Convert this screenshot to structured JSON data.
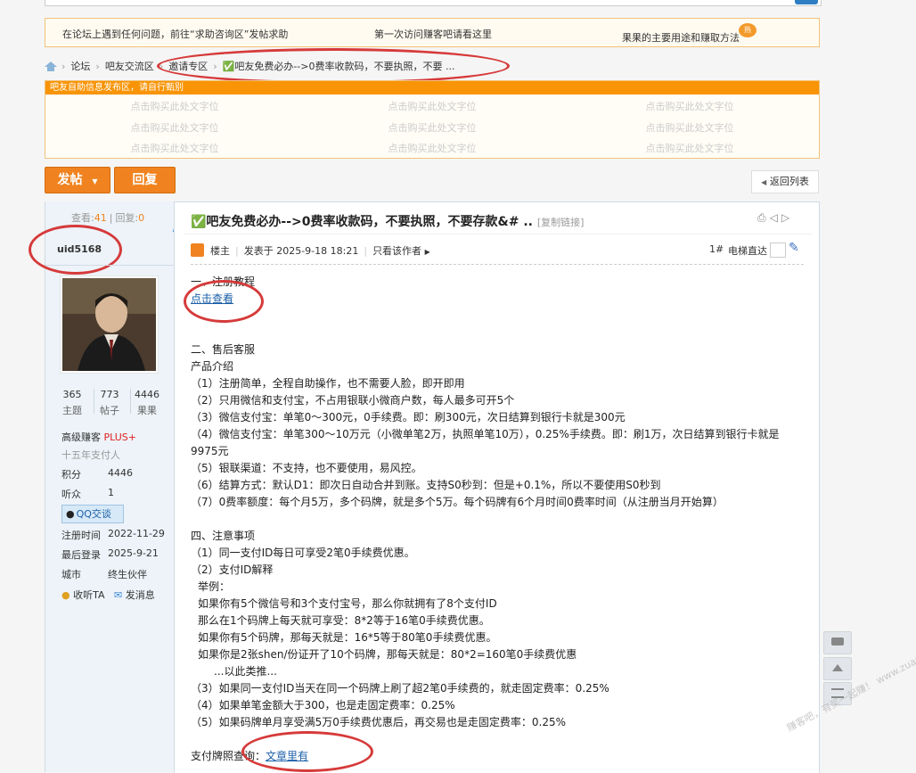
{
  "notice": {
    "left": "在论坛上遇到任何问题，前往“求助咨询区”发帖求助",
    "mid": "第一次访问赚客吧请看这里",
    "right": "果果的主要用途和赚取方法",
    "badge": "热"
  },
  "breadcrumb": [
    "论坛",
    "吧友交流区",
    "邀请专区",
    "✅吧友免费必办-->0费率收款码，不要执照，不要 ..."
  ],
  "ad": {
    "header": "吧友自助信息发布区，请自行甄别",
    "cell": "点击购买此处文字位"
  },
  "actions": {
    "post": "发帖",
    "reply": "回复",
    "back": "返回列表"
  },
  "user": {
    "views_label": "查看:",
    "views": "41",
    "replies_label": "回复:",
    "replies": "0",
    "name": "uid5168",
    "topics": "365",
    "topics_label": "主题",
    "posts": "773",
    "posts_label": "帖子",
    "fruit": "4446",
    "fruit_label": "果果",
    "level": "高级赚客",
    "plus": "PLUS+",
    "title2": "十五年支付人",
    "points_label": "积分",
    "points": "4446",
    "fans_label": "听众",
    "fans": "1",
    "qq": "QQ交谈",
    "reg_label": "注册时间",
    "reg": "2022-11-29",
    "last_label": "最后登录",
    "last": "2025-9-21",
    "city_label": "城市",
    "city": "终生伙伴",
    "follow": "收听TA",
    "msg": "发消息"
  },
  "post": {
    "title": "✅吧友免费必办-->0费率收款码，不要执照，不要存款&# ..",
    "copy": "[复制链接]",
    "owner": "楼主",
    "time": "发表于 2025-9-18 18:21",
    "author_only": "只看该作者",
    "floor": "1#",
    "jump": "电梯直达"
  },
  "content": {
    "l1": "一、注册教程",
    "link1": "点击查看",
    "l2": "二、售后客服",
    "l3": "产品介绍",
    "l4": "（1）注册简单，全程自助操作，也不需要人脸，即开即用",
    "l5": "（2）只用微信和支付宝，不占用银联小微商户数，每人最多可开5个",
    "l6": "（3）微信支付宝：单笔0～300元，0手续费。即：刷300元，次日结算到银行卡就是300元",
    "l7": "（4）微信支付宝：单笔300～10万元（小微单笔2万，执照单笔10万），0.25%手续费。即：刷1万，次日结算到银行卡就是",
    "l7b": "9975元",
    "l8": "（5）银联渠道：不支持，也不要使用，易风控。",
    "l9": "（6）结算方式：默认D1：即次日自动合并到账。支持S0秒到：但是+0.1%，所以不要使用S0秒到",
    "l10": "（7）0费率额度：每个月5万，多个码牌，就是多个5万。每个码牌有6个月时间0费率时间（从注册当月开始算）",
    "l11": "四、注意事项",
    "l12": "（1）同一支付ID每日可享受2笔0手续费优惠。",
    "l13": "（2）支付ID解释",
    "l14": "举例：",
    "l15": "如果你有5个微信号和3个支付宝号，那么你就拥有了8个支付ID",
    "l16": "那么在1个码牌上每天就可享受：8*2等于16笔0手续费优惠。",
    "l17": "如果你有5个码牌，那每天就是：16*5等于80笔0手续费优惠。",
    "l18": "如果你是2张shen/份证开了10个码牌，那每天就是：80*2=160笔0手续费优惠",
    "l19": "...以此类推...",
    "l20": "（3）如果同一支付ID当天在同一个码牌上刷了超2笔0手续费的，就走固定费率：0.25%",
    "l21": "（4）如果单笔金额大于300，也是走固定费率：0.25%",
    "l22": "（5）如果码牌单月享受满5万0手续费优惠后，再交易也是走固定费率：0.25%",
    "l23": "支付牌照查询：",
    "link2": "文章里有"
  },
  "watermark": "赚客吧，有奖一起赚！ www.zuanke8.com",
  "colors": {
    "accent": "#f0831f",
    "annotation": "#d63a3a",
    "link": "#1a5fa8"
  }
}
